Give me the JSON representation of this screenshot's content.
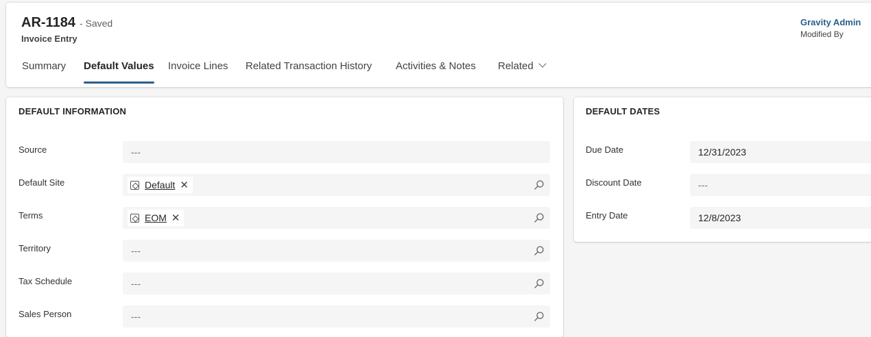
{
  "record": {
    "id": "AR-1184",
    "status": "- Saved",
    "entity": "Invoice Entry",
    "owner_name": "Gravity Admin",
    "owner_label": "Modified By"
  },
  "tabs": [
    {
      "label": "Summary",
      "active": false
    },
    {
      "label": "Default Values",
      "active": true
    },
    {
      "label": "Invoice Lines",
      "active": false
    },
    {
      "label": "Related Transaction History",
      "active": false
    },
    {
      "label": "Activities & Notes",
      "active": false
    },
    {
      "label": "Related",
      "active": false,
      "icon": "chevron-down-icon"
    }
  ],
  "default_information": {
    "title": "DEFAULT INFORMATION",
    "fields": [
      {
        "label": "Source",
        "value": "---"
      },
      {
        "label": "Default Site",
        "tag": "Default",
        "icon": "record-icon"
      },
      {
        "label": "Terms",
        "tag": "EOM",
        "icon": "record-icon"
      },
      {
        "label": "Territory",
        "value": "---"
      },
      {
        "label": "Tax Schedule",
        "value": "---"
      },
      {
        "label": "Sales Person",
        "value": "---"
      }
    ]
  },
  "default_dates": {
    "title": "DEFAULT DATES",
    "fields": [
      {
        "label": "Due Date",
        "value": "12/31/2023"
      },
      {
        "label": "Discount Date",
        "value": "---"
      },
      {
        "label": "Entry Date",
        "value": "12/8/2023"
      }
    ]
  },
  "icons": {
    "search": "search-icon",
    "remove": "close-icon"
  }
}
